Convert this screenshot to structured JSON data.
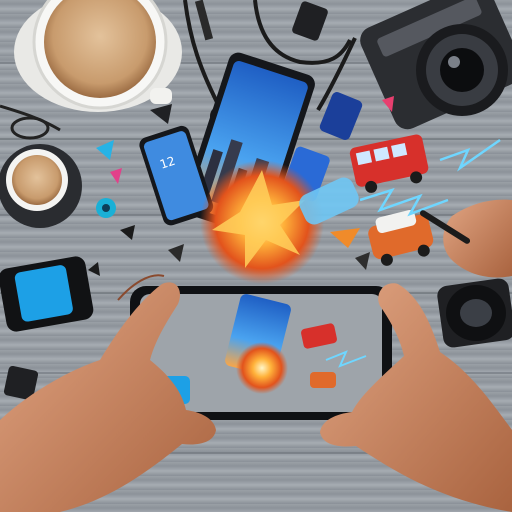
{
  "scene": {
    "colors": {
      "table": "#9aa0a6",
      "coffee": "#c89b6d",
      "cup": "#f4f4f2",
      "phone_screen_sky": "#2f7fd8",
      "bus_red": "#d7302b",
      "car_orange": "#e06a2b",
      "camera_black": "#2b2d31",
      "battery_blue": "#1da0e6",
      "spark_orange": "#ff8a1c",
      "lightning": "#6fd6ff",
      "skin": "#c9865f"
    },
    "objects": [
      {
        "name": "coffee-cup-large-icon"
      },
      {
        "name": "coffee-cup-small-icon"
      },
      {
        "name": "camera-icon"
      },
      {
        "name": "lens-icon"
      },
      {
        "name": "battery-icon"
      },
      {
        "name": "smartphone-held-icon"
      },
      {
        "name": "smartphone-floating-icon"
      },
      {
        "name": "toy-bus-icon"
      },
      {
        "name": "toy-car-icon"
      },
      {
        "name": "explosion-icon"
      },
      {
        "name": "lightning-icon"
      },
      {
        "name": "hand-left-icon"
      },
      {
        "name": "hand-right-icon"
      },
      {
        "name": "stylus-icon"
      },
      {
        "name": "usb-drive-icon"
      },
      {
        "name": "headphones-cable-icon"
      }
    ]
  }
}
